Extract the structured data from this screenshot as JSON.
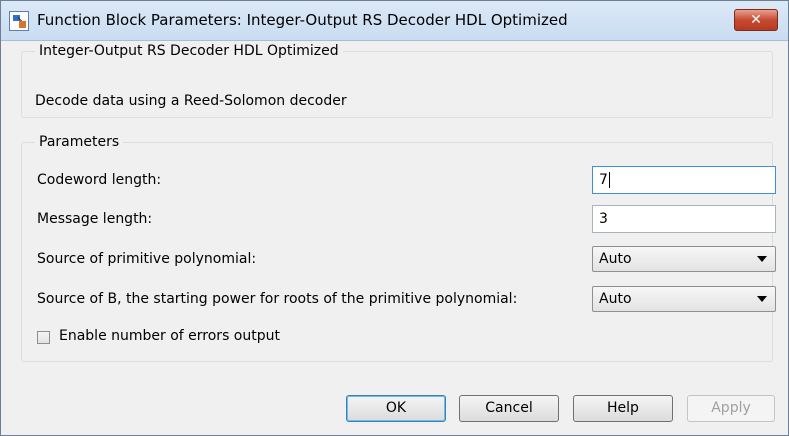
{
  "window": {
    "title": "Function Block Parameters: Integer-Output RS Decoder HDL Optimized",
    "close_symbol": "✕"
  },
  "block": {
    "name": "Integer-Output RS Decoder HDL Optimized",
    "description": "Decode data using a Reed-Solomon decoder"
  },
  "parameters": {
    "legend": "Parameters",
    "codeword_length": {
      "label": "Codeword length:",
      "value": "7"
    },
    "message_length": {
      "label": "Message length:",
      "value": "3"
    },
    "primitive_polynomial_source": {
      "label": "Source of primitive polynomial:",
      "value": "Auto"
    },
    "b_source": {
      "label": "Source of B, the starting power for roots of the primitive polynomial:",
      "value": "Auto"
    },
    "enable_errors_output": {
      "label": "Enable number of errors output",
      "checked": false
    }
  },
  "buttons": {
    "ok": "OK",
    "cancel": "Cancel",
    "help": "Help",
    "apply": "Apply"
  }
}
